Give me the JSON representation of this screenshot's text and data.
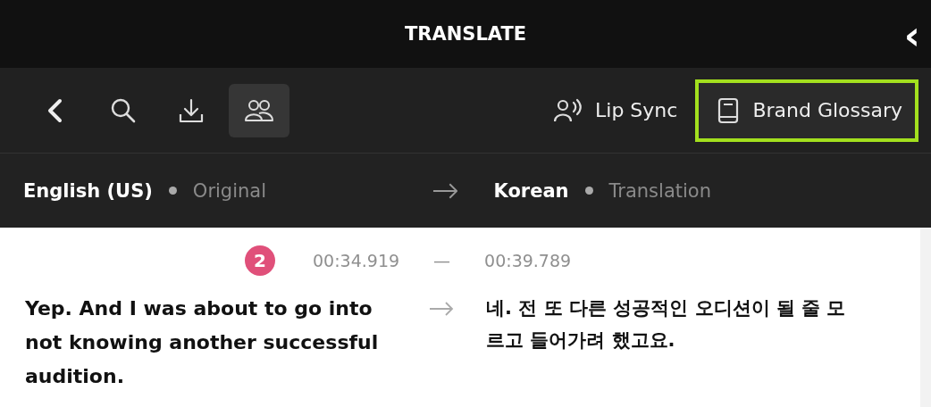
{
  "header": {
    "title": "TRANSLATE",
    "collapse_icon": "‹"
  },
  "toolbar": {
    "tools": [
      {
        "kind": "back",
        "selected": false
      },
      {
        "kind": "search",
        "selected": false
      },
      {
        "kind": "download",
        "selected": false
      },
      {
        "kind": "speakers",
        "selected": true
      }
    ],
    "lip_sync": {
      "label": "Lip Sync"
    },
    "brand_glossary": {
      "label": "Brand Glossary",
      "highlighted": true
    }
  },
  "languages": {
    "source": {
      "name": "English (US)",
      "role": "Original"
    },
    "target": {
      "name": "Korean",
      "role": "Translation"
    }
  },
  "segments": [
    {
      "number": "2",
      "start": "00:34.919",
      "end": "00:39.789",
      "dash": "—",
      "source_text": "Yep. And I was about to go into not knowing another successful audition.",
      "target_text": "네. 전 또 다른 성공적인 오디션이 될 줄 모르고 들어가려 했고요."
    }
  ]
}
